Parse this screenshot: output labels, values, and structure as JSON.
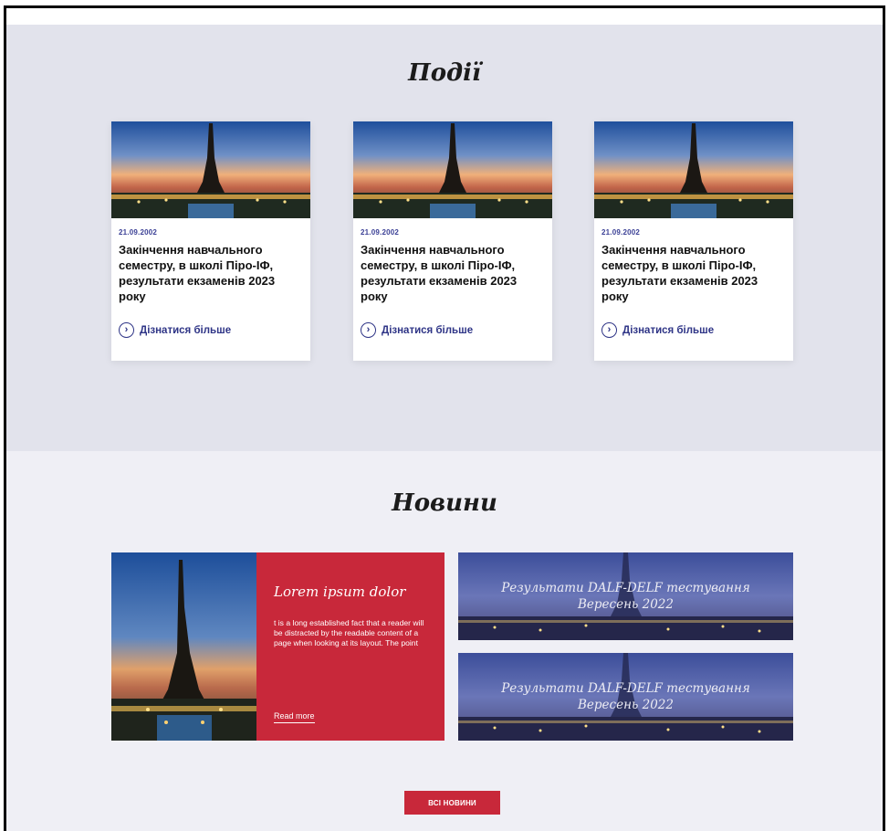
{
  "events": {
    "title": "Події",
    "cards": [
      {
        "date": "21.09.2002",
        "title": "Закінчення навчального семестру, в школі Піро-ІФ, результати екзаменів 2023 року",
        "more_label": "Дізнатися більше"
      },
      {
        "date": "21.09.2002",
        "title": "Закінчення навчального семестру, в школі Піро-ІФ, результати екзаменів 2023 року",
        "more_label": "Дізнатися більше"
      },
      {
        "date": "21.09.2002",
        "title": "Закінчення навчального семестру, в школі Піро-ІФ, результати екзаменів 2023 року",
        "more_label": "Дізнатися більше"
      }
    ]
  },
  "news": {
    "title": "Новини",
    "feature": {
      "title": "Lorem ipsum dolor",
      "text": "t is a long established fact that a reader will be distracted by the readable content of a page when looking at its layout. The point",
      "more_label": "Read more"
    },
    "banners": [
      {
        "line1": "Результати DALF-DELF тестування",
        "line2": "Вересень 2022"
      },
      {
        "line1": "Результати DALF-DELF тестування",
        "line2": "Вересень 2022"
      }
    ],
    "all_news_label": "ВСІ НОВИНИ"
  },
  "colors": {
    "accent_red": "#c8283a",
    "link_blue": "#2e3486",
    "events_bg": "#e2e3ec",
    "news_bg": "#efeff5"
  },
  "icons": {
    "more": "chevron-right-circle-icon",
    "photo": "eiffel-tower-photo"
  }
}
